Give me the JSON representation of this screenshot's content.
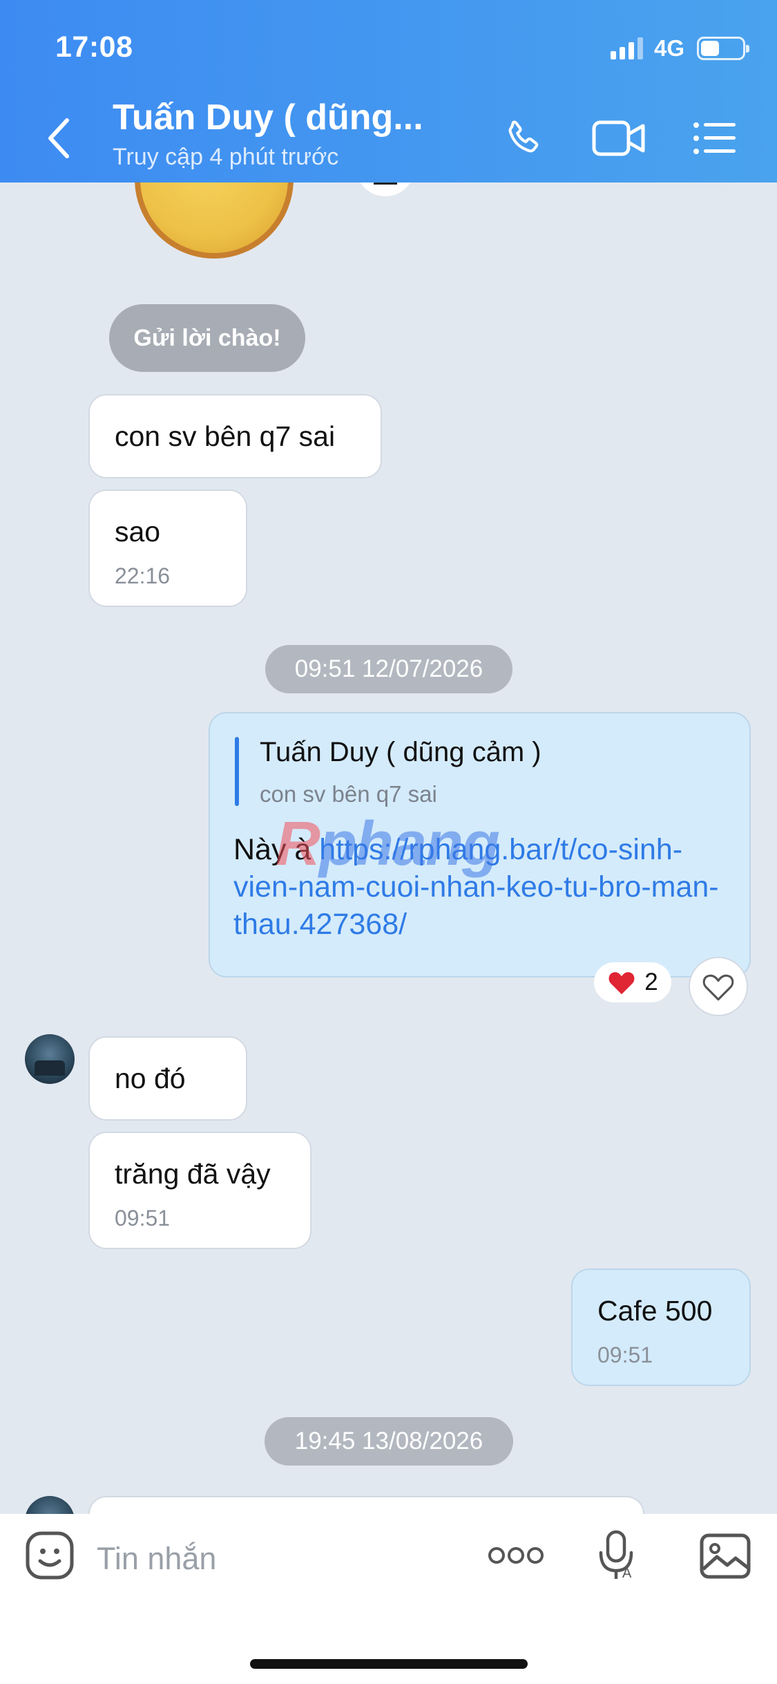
{
  "status_bar": {
    "time": "17:08",
    "network": "4G",
    "battery_level": 0.45
  },
  "header": {
    "contact_name": "Tuấn Duy ( dũng...",
    "contact_status": "Truy cập 4 phút trước",
    "icons": [
      "back-icon",
      "phone-icon",
      "video-call-icon",
      "menu-list-icon"
    ]
  },
  "chat": {
    "greeting_button": "Gửi lời chào!",
    "messages": [
      {
        "side": "incoming",
        "text": "con sv bên q7 sai"
      },
      {
        "side": "incoming",
        "text": "sao",
        "time": "22:16"
      },
      {
        "side": "incoming",
        "text": "no đó"
      },
      {
        "side": "incoming",
        "text": "trăng đã vậy",
        "time": "09:51"
      },
      {
        "side": "outgoing",
        "text": "Cafe 500",
        "time": "09:51"
      }
    ],
    "date_separators": [
      "09:51 12/07/2026",
      "19:45 13/08/2026"
    ],
    "reply_message": {
      "quoted_name": "Tuấn Duy ( dũng cảm )",
      "quoted_text": "con sv bên q7 sai",
      "prefix": "Này à ",
      "link": "https://rphang.bar/t/co-sinh-vien-nam-cuoi-nhan-keo-tu-bro-man-thau.427368/",
      "reaction_count": "2"
    },
    "watermark": {
      "part1": "R",
      "part2": "phang"
    }
  },
  "input_bar": {
    "placeholder": "Tin nhắn"
  },
  "colors": {
    "header": "#3d8bf2",
    "link": "#2f7be6",
    "outgoing_bubble": "#d4ebfb",
    "background": "#e2e8f0"
  }
}
